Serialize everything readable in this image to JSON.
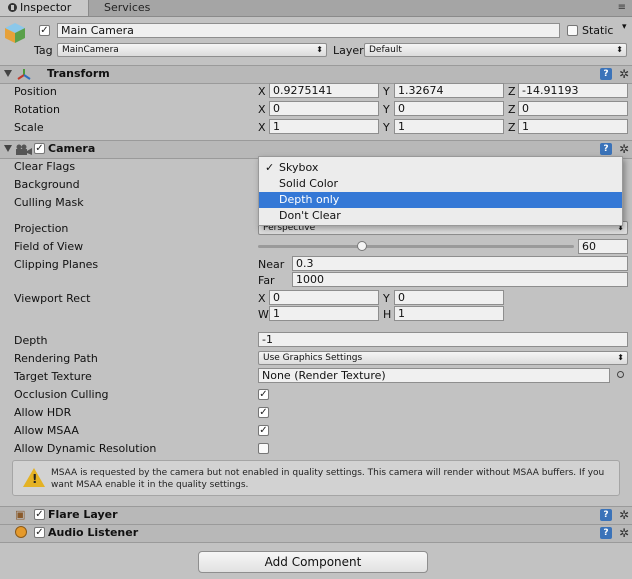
{
  "tabs": {
    "inspector": "Inspector",
    "services": "Services"
  },
  "object": {
    "name": "Main Camera",
    "static_label": "Static",
    "active": true,
    "static": false
  },
  "tag": {
    "label": "Tag",
    "value": "MainCamera"
  },
  "layer": {
    "label": "Layer",
    "value": "Default"
  },
  "transform": {
    "title": "Transform",
    "position": {
      "label": "Position",
      "x": "0.9275141",
      "y": "1.32674",
      "z": "-14.91193"
    },
    "rotation": {
      "label": "Rotation",
      "x": "0",
      "y": "0",
      "z": "0"
    },
    "scale": {
      "label": "Scale",
      "x": "1",
      "y": "1",
      "z": "1"
    },
    "axis": {
      "x": "X",
      "y": "Y",
      "z": "Z",
      "w": "W",
      "h": "H"
    }
  },
  "camera": {
    "title": "Camera",
    "enabled": true,
    "clear_flags": "Clear Flags",
    "background": "Background",
    "culling_mask": "Culling Mask",
    "projection": {
      "label": "Projection",
      "value": "Perspective"
    },
    "fov": {
      "label": "Field of View",
      "value": "60",
      "fraction": 0.33
    },
    "clipping": {
      "label": "Clipping Planes",
      "near_label": "Near",
      "near": "0.3",
      "far_label": "Far",
      "far": "1000"
    },
    "viewport": {
      "label": "Viewport Rect",
      "x": "0",
      "y": "0",
      "w": "1",
      "h": "1"
    },
    "depth": {
      "label": "Depth",
      "value": "-1"
    },
    "rendering_path": {
      "label": "Rendering Path",
      "value": "Use Graphics Settings"
    },
    "target_texture": {
      "label": "Target Texture",
      "value": "None (Render Texture)"
    },
    "occlusion": {
      "label": "Occlusion Culling",
      "checked": true
    },
    "hdr": {
      "label": "Allow HDR",
      "checked": true
    },
    "msaa": {
      "label": "Allow MSAA",
      "checked": true
    },
    "dynres": {
      "label": "Allow Dynamic Resolution",
      "checked": false
    },
    "warning": "MSAA is requested by the camera but not enabled in quality settings. This camera will render without MSAA buffers. If you want MSAA enable it in the quality settings."
  },
  "dropdown": {
    "options": [
      "Skybox",
      "Solid Color",
      "Depth only",
      "Don't Clear"
    ],
    "checked_index": 0,
    "highlighted_index": 2
  },
  "flare": {
    "title": "Flare Layer",
    "enabled": true
  },
  "audio": {
    "title": "Audio Listener",
    "enabled": true
  },
  "add_component": "Add Component",
  "colors": {
    "accent": "#3478d6",
    "help": "#3b73b9",
    "warning": "#e4b224"
  }
}
